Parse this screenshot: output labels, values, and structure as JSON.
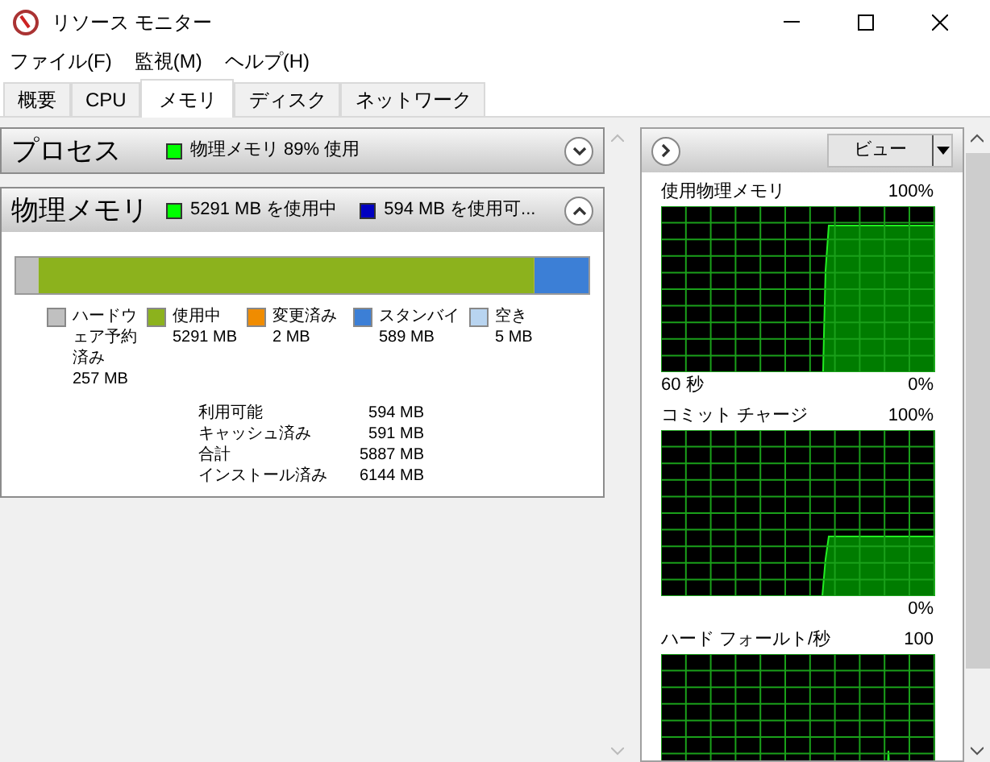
{
  "window": {
    "title": "リソース モニター"
  },
  "menu": [
    "ファイル(F)",
    "監視(M)",
    "ヘルプ(H)"
  ],
  "tabs": [
    {
      "label": "概要",
      "selected": false
    },
    {
      "label": "CPU",
      "selected": false
    },
    {
      "label": "メモリ",
      "selected": true
    },
    {
      "label": "ディスク",
      "selected": false
    },
    {
      "label": "ネットワーク",
      "selected": false
    }
  ],
  "sections": [
    {
      "title": "プロセス",
      "expanded": false,
      "indicators": [
        {
          "text": "物理メモリ 89% 使用",
          "color": "#00ff00"
        }
      ]
    },
    {
      "title": "物理メモリ",
      "expanded": true,
      "indicators": [
        {
          "text": "5291 MB を使用中",
          "color": "#00ff00"
        },
        {
          "text": "594 MB を使用可...",
          "color": "#0000c0"
        }
      ]
    }
  ],
  "memory_legend": [
    {
      "label": "ハードウェア予約済み",
      "value": "257 MB",
      "color": "#c0c0c0"
    },
    {
      "label": "使用中",
      "value": "5291 MB",
      "color": "#8cb21d"
    },
    {
      "label": "変更済み",
      "value": "2 MB",
      "color": "#f08c00"
    },
    {
      "label": "スタンバイ",
      "value": "589 MB",
      "color": "#3c7fd6"
    },
    {
      "label": "空き",
      "value": "5 MB",
      "color": "#b8d4f0"
    }
  ],
  "memory_stats": [
    {
      "label": "利用可能",
      "value": "594 MB"
    },
    {
      "label": "キャッシュ済み",
      "value": "591 MB"
    },
    {
      "label": "合計",
      "value": "5887 MB"
    },
    {
      "label": "インストール済み",
      "value": "6144 MB"
    }
  ],
  "view_button": "ビュー",
  "graphs": [
    {
      "title": "使用物理メモリ",
      "max": "100%",
      "time": "60 秒",
      "min": "0%"
    },
    {
      "title": "コミット チャージ",
      "max": "100%",
      "min": "0%"
    },
    {
      "title": "ハード フォールト/秒",
      "max": "100"
    }
  ]
}
